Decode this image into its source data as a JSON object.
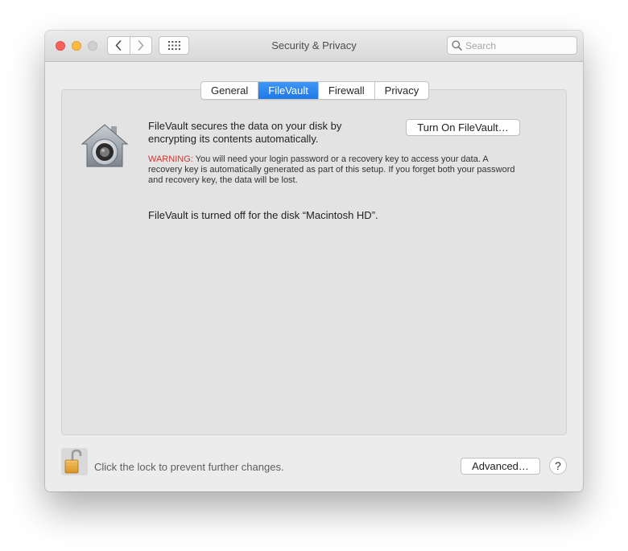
{
  "window": {
    "title": "Security & Privacy"
  },
  "toolbar": {
    "search_placeholder": "Search",
    "back_icon": "chevron-left-icon",
    "forward_icon": "chevron-right-icon",
    "show_all_icon": "grid-icon"
  },
  "tabs": [
    {
      "label": "General",
      "active": false
    },
    {
      "label": "FileVault",
      "active": true
    },
    {
      "label": "Firewall",
      "active": false
    },
    {
      "label": "Privacy",
      "active": false
    }
  ],
  "filevault": {
    "icon": "filevault-house-icon",
    "description": "FileVault secures the data on your disk by encrypting its contents automatically.",
    "turn_on_label": "Turn On FileVault…",
    "warning_label": "WARNING:",
    "warning_text": " You will need your login password or a recovery key to access your data. A recovery key is automatically generated as part of this setup. If you forget both your password and recovery key, the data will be lost.",
    "status": "FileVault is turned off for the disk “Macintosh HD”."
  },
  "footer": {
    "lock_icon": "unlocked-padlock-icon",
    "lock_text": "Click the lock to prevent further changes.",
    "advanced_label": "Advanced…",
    "help_label": "?"
  },
  "colors": {
    "accent": "#2a84f1",
    "warning": "#d2352e",
    "close": "#fc605c",
    "minimize": "#fdbc40",
    "zoom_disabled": "#cfcfcf"
  }
}
